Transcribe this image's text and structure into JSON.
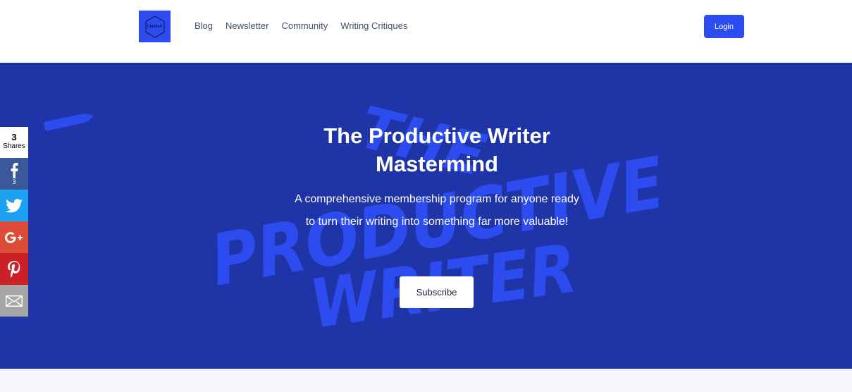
{
  "header": {
    "logo_text": "ChillFell",
    "nav": [
      "Blog",
      "Newsletter",
      "Community",
      "Writing Critiques"
    ],
    "login_label": "Login",
    "accent": "#2d4cf0"
  },
  "hero": {
    "title": "The Productive Writer Mastermind",
    "subtitle": "A comprehensive membership program for anyone ready to turn their writing into something far more valuable!",
    "subscribe_label": "Subscribe",
    "background_art_text": [
      "THE",
      "PRODUCTIVE",
      "WRITER"
    ],
    "background": "#1f35a7"
  },
  "share": {
    "count": "3",
    "count_label": "Shares",
    "facebook_count": "3",
    "icons": [
      "facebook-icon",
      "twitter-icon",
      "google-plus-icon",
      "pinterest-icon",
      "email-icon"
    ]
  }
}
